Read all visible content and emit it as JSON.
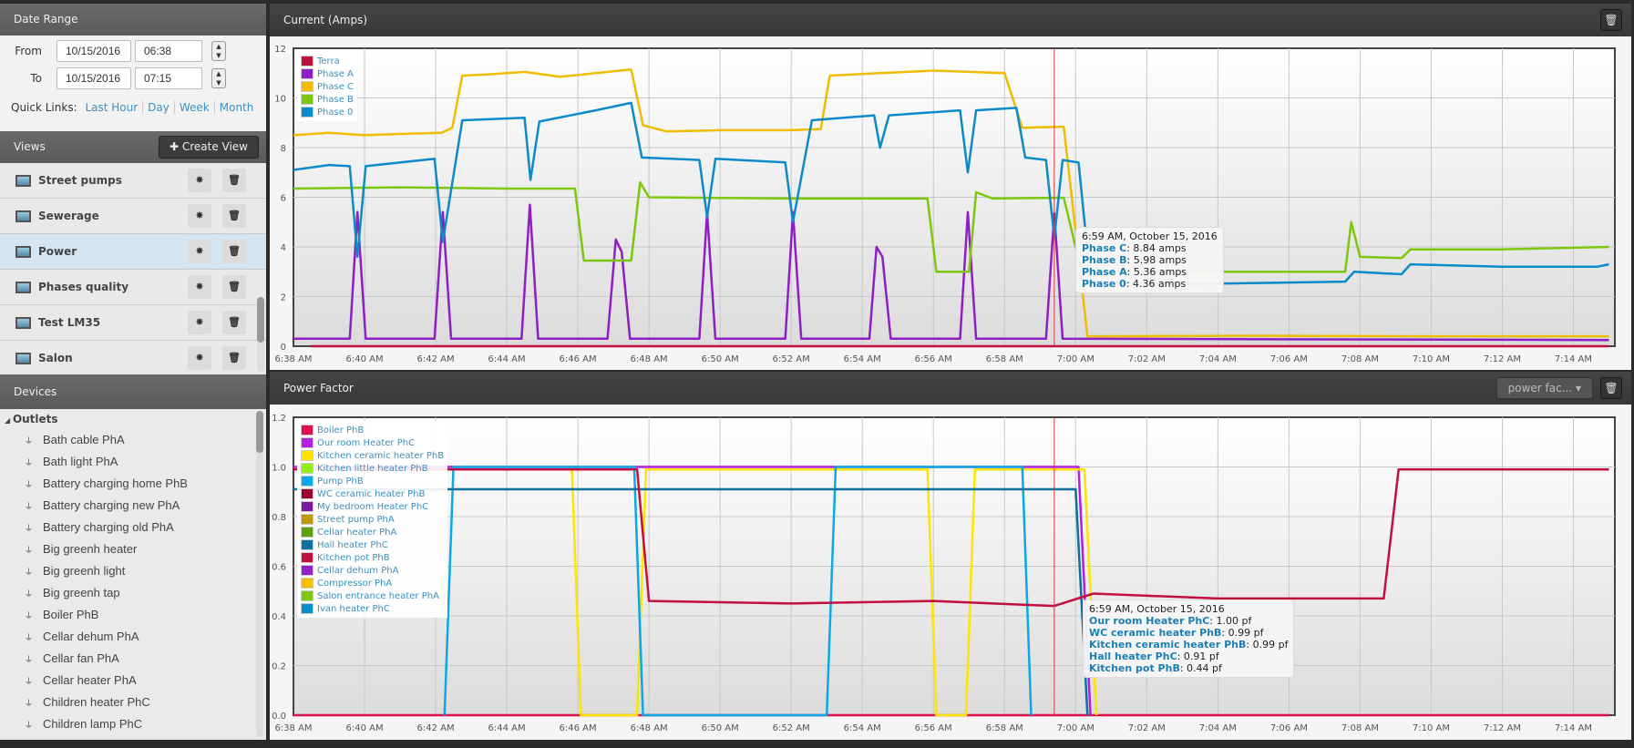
{
  "sidebar": {
    "date_range": {
      "title": "Date Range",
      "from_label": "From",
      "to_label": "To",
      "from_date": "10/15/2016",
      "from_time": "06:38",
      "to_date": "10/15/2016",
      "to_time": "07:15",
      "quick_links_label": "Quick Links:",
      "quick_links": [
        "Last Hour",
        "Day",
        "Week",
        "Month"
      ]
    },
    "views": {
      "title": "Views",
      "create_label": "Create View",
      "items": [
        {
          "label": "Street pumps"
        },
        {
          "label": "Sewerage"
        },
        {
          "label": "Power",
          "selected": true
        },
        {
          "label": "Phases quality"
        },
        {
          "label": "Test LM35"
        },
        {
          "label": "Salon"
        }
      ]
    },
    "devices": {
      "title": "Devices",
      "group": "Outlets",
      "items": [
        "Bath cable PhA",
        "Bath light PhA",
        "Battery charging home PhB",
        "Battery charging new PhA",
        "Battery charging old PhA",
        "Big greenh heater",
        "Big greenh light",
        "Big greenh tap",
        "Boiler PhB",
        "Cellar dehum PhA",
        "Cellar fan PhA",
        "Cellar heater PhA",
        "Children heater PhC",
        "Children lamp PhC"
      ]
    }
  },
  "panels": {
    "current": {
      "title": "Current (Amps)"
    },
    "pf": {
      "title": "Power Factor",
      "select_value": "power fac..."
    }
  },
  "chart_data": [
    {
      "type": "line",
      "title": "Current (Amps)",
      "ylim": [
        0,
        12
      ],
      "yticks": [
        0,
        2,
        4,
        6,
        8,
        10,
        12
      ],
      "xlim": [
        "6:38:00",
        "7:15:10"
      ],
      "xticks": [
        "6:38 AM",
        "6:40 AM",
        "6:42 AM",
        "6:44 AM",
        "6:46 AM",
        "6:48 AM",
        "6:50 AM",
        "6:52 AM",
        "6:54 AM",
        "6:56 AM",
        "6:58 AM",
        "7:00 AM",
        "7:02 AM",
        "7:04 AM",
        "7:06 AM",
        "7:08 AM",
        "7:10 AM",
        "7:12 AM",
        "7:14 AM"
      ],
      "grid": true,
      "legend": "top-left",
      "crosshair": "6:59:24",
      "series": [
        {
          "name": "Terra",
          "color": "#c0103f",
          "points": [
            [
              "6:38:30",
              0
            ],
            [
              "7:15:00",
              0
            ]
          ]
        },
        {
          "name": "Phase A",
          "color": "#8e1fc4",
          "points": [
            [
              "6:38:00",
              0.3
            ],
            [
              "6:39:35",
              0.3
            ],
            [
              "6:39:48",
              5.4
            ],
            [
              "6:40:02",
              0.3
            ],
            [
              "6:41:58",
              0.3
            ],
            [
              "6:42:12",
              5.4
            ],
            [
              "6:42:26",
              0.3
            ],
            [
              "6:44:25",
              0.3
            ],
            [
              "6:44:39",
              5.7
            ],
            [
              "6:44:53",
              0.3
            ],
            [
              "6:46:50",
              0.3
            ],
            [
              "6:47:04",
              4.3
            ],
            [
              "6:47:14",
              3.8
            ],
            [
              "6:47:28",
              0.3
            ],
            [
              "6:49:25",
              0.3
            ],
            [
              "6:49:38",
              5.4
            ],
            [
              "6:49:52",
              0.3
            ],
            [
              "6:51:50",
              0.3
            ],
            [
              "6:52:03",
              5.4
            ],
            [
              "6:52:17",
              0.3
            ],
            [
              "6:54:12",
              0.3
            ],
            [
              "6:54:24",
              4.0
            ],
            [
              "6:54:34",
              3.6
            ],
            [
              "6:54:48",
              0.3
            ],
            [
              "6:56:45",
              0.3
            ],
            [
              "6:56:58",
              5.4
            ],
            [
              "6:57:12",
              0.3
            ],
            [
              "6:59:10",
              0.3
            ],
            [
              "6:59:24",
              5.36
            ],
            [
              "6:59:38",
              0.3
            ],
            [
              "7:15:00",
              0.25
            ]
          ]
        },
        {
          "name": "Phase C",
          "color": "#f0bc00",
          "points": [
            [
              "6:38:00",
              8.5
            ],
            [
              "6:39:00",
              8.6
            ],
            [
              "6:40:00",
              8.5
            ],
            [
              "6:41:00",
              8.55
            ],
            [
              "6:42:10",
              8.6
            ],
            [
              "6:42:28",
              8.8
            ],
            [
              "6:42:45",
              10.9
            ],
            [
              "6:43:30",
              10.95
            ],
            [
              "6:44:30",
              11.05
            ],
            [
              "6:45:30",
              10.85
            ],
            [
              "6:46:30",
              11.0
            ],
            [
              "6:47:30",
              11.15
            ],
            [
              "6:47:50",
              8.9
            ],
            [
              "6:48:30",
              8.65
            ],
            [
              "6:50:00",
              8.7
            ],
            [
              "6:52:00",
              8.7
            ],
            [
              "6:52:50",
              8.75
            ],
            [
              "6:53:05",
              10.9
            ],
            [
              "6:54:30",
              11.0
            ],
            [
              "6:56:00",
              11.1
            ],
            [
              "6:58:00",
              11.0
            ],
            [
              "6:58:30",
              8.8
            ],
            [
              "6:59:40",
              8.84
            ],
            [
              "7:00:20",
              0.4
            ],
            [
              "7:05:00",
              0.42
            ],
            [
              "7:10:00",
              0.4
            ],
            [
              "7:15:00",
              0.4
            ]
          ]
        },
        {
          "name": "Phase B",
          "color": "#7dc80e",
          "points": [
            [
              "6:38:00",
              6.35
            ],
            [
              "6:41:00",
              6.4
            ],
            [
              "6:44:00",
              6.35
            ],
            [
              "6:45:55",
              6.35
            ],
            [
              "6:46:10",
              3.45
            ],
            [
              "6:47:30",
              3.45
            ],
            [
              "6:47:45",
              6.6
            ],
            [
              "6:48:00",
              6.0
            ],
            [
              "6:52:00",
              5.95
            ],
            [
              "6:55:50",
              5.95
            ],
            [
              "6:56:05",
              3.0
            ],
            [
              "6:57:00",
              3.0
            ],
            [
              "6:57:12",
              6.2
            ],
            [
              "6:57:40",
              5.95
            ],
            [
              "6:59:40",
              5.98
            ],
            [
              "7:00:10",
              3.0
            ],
            [
              "7:04:00",
              3.0
            ],
            [
              "7:07:35",
              3.0
            ],
            [
              "7:07:45",
              5.0
            ],
            [
              "7:08:00",
              3.6
            ],
            [
              "7:09:10",
              3.55
            ],
            [
              "7:09:25",
              3.9
            ],
            [
              "7:12:00",
              3.9
            ],
            [
              "7:15:00",
              4.0
            ]
          ]
        },
        {
          "name": "Phase 0",
          "color": "#0d8bc8",
          "points": [
            [
              "6:38:00",
              7.1
            ],
            [
              "6:39:00",
              7.3
            ],
            [
              "6:39:35",
              7.25
            ],
            [
              "6:39:48",
              3.6
            ],
            [
              "6:40:02",
              7.25
            ],
            [
              "6:41:58",
              7.55
            ],
            [
              "6:42:12",
              4.2
            ],
            [
              "6:42:45",
              9.1
            ],
            [
              "6:44:30",
              9.2
            ],
            [
              "6:44:40",
              6.7
            ],
            [
              "6:44:55",
              9.05
            ],
            [
              "6:46:30",
              9.5
            ],
            [
              "6:47:30",
              9.8
            ],
            [
              "6:47:48",
              7.6
            ],
            [
              "6:49:25",
              7.5
            ],
            [
              "6:49:38",
              5.2
            ],
            [
              "6:49:52",
              7.55
            ],
            [
              "6:51:50",
              7.4
            ],
            [
              "6:52:03",
              5.0
            ],
            [
              "6:52:35",
              9.1
            ],
            [
              "6:54:20",
              9.3
            ],
            [
              "6:54:30",
              8.0
            ],
            [
              "6:54:45",
              9.3
            ],
            [
              "6:56:45",
              9.5
            ],
            [
              "6:56:58",
              7.0
            ],
            [
              "6:57:12",
              9.5
            ],
            [
              "6:58:20",
              9.6
            ],
            [
              "6:58:35",
              7.6
            ],
            [
              "6:59:10",
              7.5
            ],
            [
              "6:59:24",
              4.36
            ],
            [
              "6:59:38",
              7.5
            ],
            [
              "7:00:05",
              7.4
            ],
            [
              "7:00:25",
              2.6
            ],
            [
              "7:03:00",
              2.5
            ],
            [
              "7:07:35",
              2.6
            ],
            [
              "7:07:50",
              3.0
            ],
            [
              "7:09:10",
              2.9
            ],
            [
              "7:09:25",
              3.3
            ],
            [
              "7:12:00",
              3.2
            ],
            [
              "7:14:40",
              3.2
            ],
            [
              "7:15:00",
              3.3
            ]
          ]
        }
      ],
      "tooltip": {
        "title": "6:59 AM, October 15, 2016",
        "rows": [
          {
            "name": "Phase C",
            "value": ": 8.84 amps"
          },
          {
            "name": "Phase B",
            "value": ": 5.98 amps"
          },
          {
            "name": "Phase A",
            "value": ": 5.36 amps"
          },
          {
            "name": "Phase 0",
            "value": ": 4.36 amps"
          }
        ]
      }
    },
    {
      "type": "line",
      "title": "Power Factor",
      "ylim": [
        0,
        1.2
      ],
      "yticks": [
        0.0,
        0.2,
        0.4,
        0.6,
        0.8,
        1.0,
        1.2
      ],
      "ytick_labels": [
        "0.0",
        "0.2",
        "0.4",
        "0.6",
        "0.8",
        "1.0",
        "1.2"
      ],
      "xlim": [
        "6:38:00",
        "7:15:10"
      ],
      "xticks": [
        "6:38 AM",
        "6:40 AM",
        "6:42 AM",
        "6:44 AM",
        "6:46 AM",
        "6:48 AM",
        "6:50 AM",
        "6:52 AM",
        "6:54 AM",
        "6:56 AM",
        "6:58 AM",
        "7:00 AM",
        "7:02 AM",
        "7:04 AM",
        "7:06 AM",
        "7:08 AM",
        "7:10 AM",
        "7:12 AM",
        "7:14 AM"
      ],
      "grid": true,
      "legend": "top-left",
      "crosshair": "6:59:24",
      "series": [
        {
          "name": "Boiler PhB",
          "color": "#e0104f",
          "points": [
            [
              "6:38:00",
              0
            ],
            [
              "7:15:00",
              0
            ]
          ]
        },
        {
          "name": "Our room Heater PhC",
          "color": "#b020e0",
          "points": [
            [
              "6:38:00",
              1.0
            ],
            [
              "7:00:05",
              1.0
            ],
            [
              "7:00:25",
              0
            ]
          ]
        },
        {
          "name": "Kitchen ceramic heater PhB",
          "color": "#ffe400",
          "points": [
            [
              "6:38:00",
              0.99
            ],
            [
              "6:45:50",
              0.99
            ],
            [
              "6:46:05",
              0
            ],
            [
              "6:47:40",
              0
            ],
            [
              "6:47:55",
              0.99
            ],
            [
              "6:55:50",
              0.99
            ],
            [
              "6:56:05",
              0
            ],
            [
              "6:56:55",
              0
            ],
            [
              "6:57:10",
              0.99
            ],
            [
              "7:00:15",
              0.99
            ],
            [
              "7:00:35",
              0
            ]
          ]
        },
        {
          "name": "Kitchen little heater PhB",
          "color": "#90f010",
          "points": []
        },
        {
          "name": "Pump PhB",
          "color": "#0aa8e8",
          "points": [
            [
              "6:42:15",
              0
            ],
            [
              "6:42:30",
              1.0
            ],
            [
              "6:47:35",
              1.0
            ],
            [
              "6:47:50",
              0
            ],
            [
              "6:53:00",
              0
            ],
            [
              "6:53:15",
              1.0
            ],
            [
              "6:58:30",
              1.0
            ],
            [
              "6:58:45",
              0
            ]
          ]
        },
        {
          "name": "WC ceramic heater PhB",
          "color": "#9a0030",
          "points": []
        },
        {
          "name": "My bedroom Heater PhC",
          "color": "#7a1a9a",
          "points": []
        },
        {
          "name": "Street pump PhA",
          "color": "#c09a00",
          "points": []
        },
        {
          "name": "Cellar heater PhA",
          "color": "#60a010",
          "points": []
        },
        {
          "name": "Hall heater PhC",
          "color": "#0c70a0",
          "points": [
            [
              "6:38:00",
              0.91
            ],
            [
              "7:00:00",
              0.91
            ],
            [
              "7:00:20",
              0
            ]
          ]
        },
        {
          "name": "Kitchen pot PhB",
          "color": "#c0103f",
          "points": [
            [
              "6:38:00",
              0.99
            ],
            [
              "6:47:40",
              0.99
            ],
            [
              "6:48:00",
              0.46
            ],
            [
              "6:52:00",
              0.45
            ],
            [
              "6:56:00",
              0.46
            ],
            [
              "6:59:24",
              0.44
            ],
            [
              "7:00:30",
              0.49
            ],
            [
              "7:04:00",
              0.47
            ],
            [
              "7:08:40",
              0.47
            ],
            [
              "7:09:05",
              0.99
            ],
            [
              "7:15:00",
              0.99
            ]
          ]
        },
        {
          "name": "Cellar dehum PhA",
          "color": "#9020c8",
          "points": []
        },
        {
          "name": "Compressor PhA",
          "color": "#f0c000",
          "points": []
        },
        {
          "name": "Salon entrance heater PhA",
          "color": "#80c810",
          "points": []
        },
        {
          "name": "Ivan heater PhC",
          "color": "#0890c8",
          "points": []
        }
      ],
      "tooltip": {
        "title": "6:59 AM, October 15, 2016",
        "rows": [
          {
            "name": "Our room Heater PhC",
            "value": ": 1.00 pf"
          },
          {
            "name": "WC ceramic heater PhB",
            "value": ": 0.99 pf"
          },
          {
            "name": "Kitchen ceramic heater PhB",
            "value": ": 0.99 pf"
          },
          {
            "name": "Hall heater PhC",
            "value": ": 0.91 pf"
          },
          {
            "name": "Kitchen pot PhB",
            "value": ": 0.44 pf"
          }
        ]
      }
    }
  ]
}
